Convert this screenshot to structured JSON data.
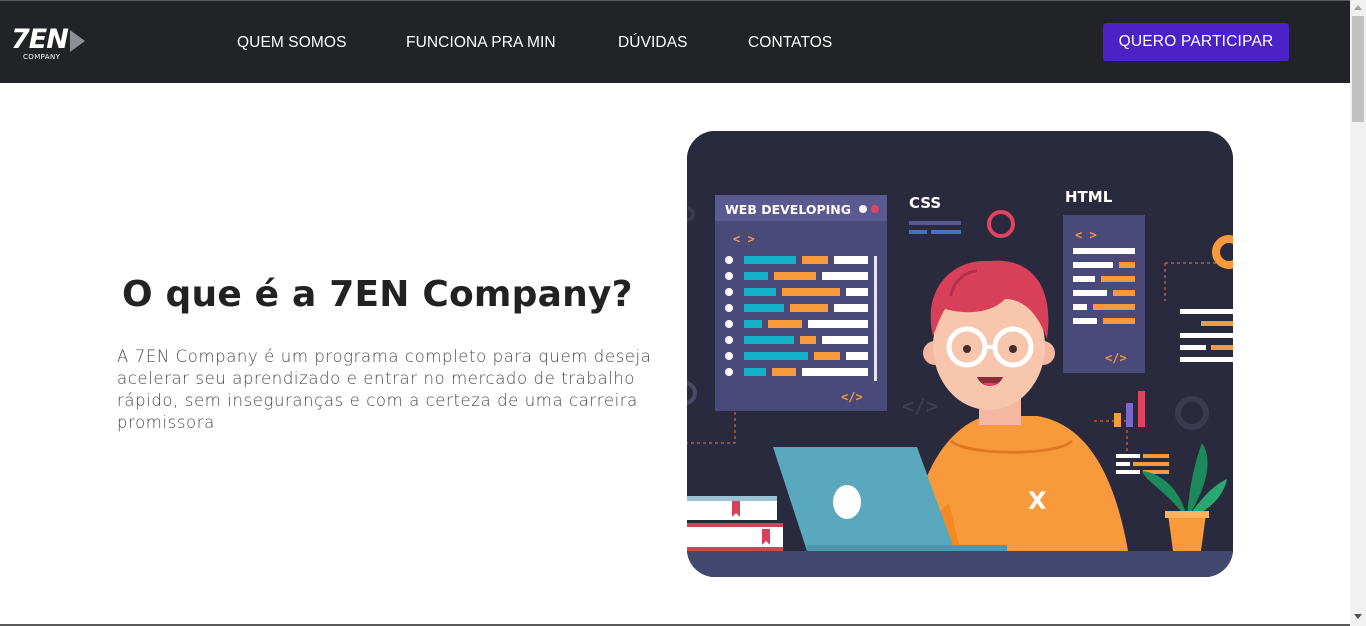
{
  "brand": {
    "logo_main": "7EN",
    "logo_sub": "COMPANY"
  },
  "nav": {
    "items": [
      {
        "label": "QUEM SOMOS"
      },
      {
        "label": "FUNCIONA PRA MIN"
      },
      {
        "label": "DÚVIDAS"
      },
      {
        "label": "CONTATOS"
      }
    ],
    "cta_label": "QUERO PARTICIPAR"
  },
  "hero": {
    "title": "O que é a 7EN Company?",
    "description": "A 7EN Company é um programa completo para quem deseja acelerar seu aprendizado e entrar no mercado de trabalho rápido, sem inseguranças e com a certeza de uma carreira promissora"
  },
  "illustration": {
    "panel_title": "WEB DEVELOPING",
    "css_label": "CSS",
    "html_label": "HTML",
    "code_open": "< >",
    "code_close": "</>",
    "laptop_mark": "X"
  },
  "colors": {
    "nav_bg": "#212327",
    "cta_bg": "#4a22c6",
    "illustration_bg": "#2a2a3e",
    "accent_orange": "#f89a3c",
    "accent_teal": "#16b3c8"
  }
}
